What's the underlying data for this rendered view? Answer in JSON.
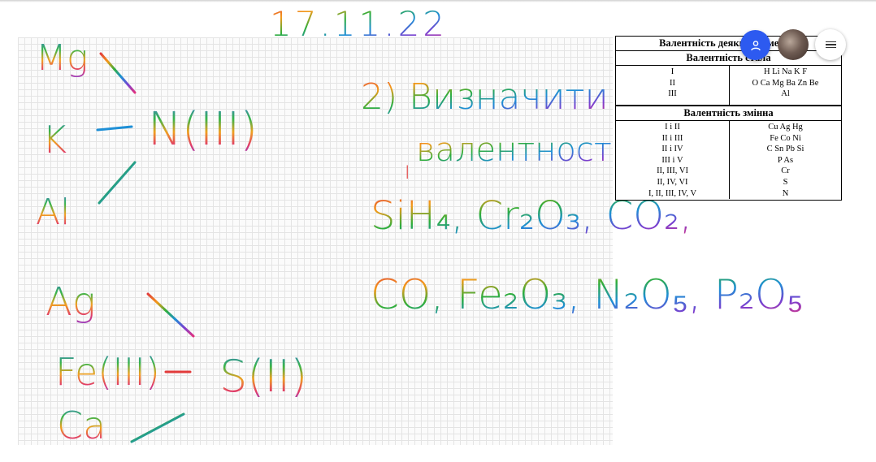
{
  "board": {
    "date": "17.11.22",
    "left_col": {
      "mg": "Mg",
      "k": "K",
      "al": "Al",
      "n3": "N(III)",
      "ag": "Ag",
      "fe3": "Fe(III)",
      "ca": "Ca",
      "s2": "S(II)"
    },
    "task": {
      "line1": "2) Визначити",
      "line2": "валентності",
      "mark": "I",
      "formulas1": "SiH₄, Cr₂O₃, CO₂,",
      "formulas2": "CO, Fe₂O₃, N₂O₅, P₂O₅"
    }
  },
  "table": {
    "title": "Валентність деяких елементів",
    "const_header": "Валентність стала",
    "const_left": [
      "I",
      "II",
      "III"
    ],
    "const_right": [
      "H  Li  Na  K  F",
      "O  Ca  Mg  Ba  Zn  Be",
      "Al"
    ],
    "var_header": "Валентність змінна",
    "var_left": [
      "I і II",
      "II і III",
      "II і IV",
      "III і V",
      "II, III, VI",
      "II, IV, VI",
      "I, II, III, IV, V"
    ],
    "var_right": [
      "Cu  Ag  Hg",
      "Fe  Co  Ni",
      "C  Sn  Pb  Si",
      "P  As",
      "Cr",
      "S",
      "N"
    ]
  },
  "controls": {
    "participants_icon": "person-icon",
    "menu_icon": "hamburger-icon"
  },
  "colors": {
    "fab": "#2d5af0"
  }
}
